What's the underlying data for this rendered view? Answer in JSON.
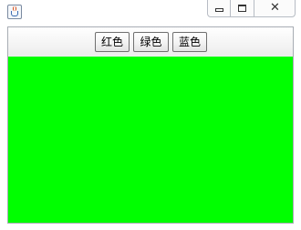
{
  "window": {
    "icon": "java-cup-icon"
  },
  "toolbar": {
    "buttons": [
      {
        "label": "红色"
      },
      {
        "label": "绿色"
      },
      {
        "label": "蓝色"
      }
    ]
  },
  "panel": {
    "background_color": "#00ff00"
  },
  "colors": {
    "panel_green": "#00ff00",
    "button_border": "#707070"
  }
}
